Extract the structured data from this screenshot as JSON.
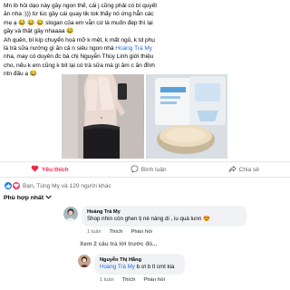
{
  "post": {
    "lines": [
      "Mn ib hỏi dạo này gầy ngon thế, cái j cũng phải có bí quyết",
      "ăn nha :))) từ lúc gầy cái quay tik tok thấy nó ứng hẳn các",
      "mẹ ạ 😂 😂 😂 slogan của em vẫn cứ là muốn đẹp thì lại",
      "gầy và thật gầy nhaaaa 😂",
      "Ah quên, bí kíp chuyển hoá mỡ k mệt, k mất ngủ, k td phụ",
      "là trà sữa nướng gì ăn cả n siêu ngon nhá ",
      "nha, may có duyên đc bà chị Nguyễn Thùy Linh giới thiệu",
      "cho, nếu k em cũng k bít lại có trà sữa mà gì ăm c ăn đỉnh",
      "ntn đấu ạ 😂"
    ],
    "mention": "Hoàng Trà My"
  },
  "actions": {
    "like": "Yêu thích",
    "comment": "Bình luận",
    "share": "Chia sẻ"
  },
  "reactions": {
    "text": "Bạn, Tùng My và 129 người khác"
  },
  "sort": {
    "label": "Phù hợp nhất"
  },
  "comments": [
    {
      "author": "Hoàng Trà My",
      "text": "Shop nhìn còn ghen tị nè nàng di , iu quá lunn 😍",
      "time": "1 tuần",
      "like": "Thích",
      "reply": "Phản hồi"
    }
  ],
  "view_replies": "Xem 2 câu trả lời trước đó...",
  "reply": {
    "author": "Nguyễn Thị Hằng",
    "mention": "Hoàng Trà My",
    "text": " b ơi b tl cmt kia",
    "time": "1 tuần",
    "like": "Thích",
    "reply": "Phản hồi"
  },
  "colors": {
    "link": "#216fdb",
    "love": "#f02849",
    "bubble": "#f0f2f5",
    "muted": "#65676b"
  }
}
